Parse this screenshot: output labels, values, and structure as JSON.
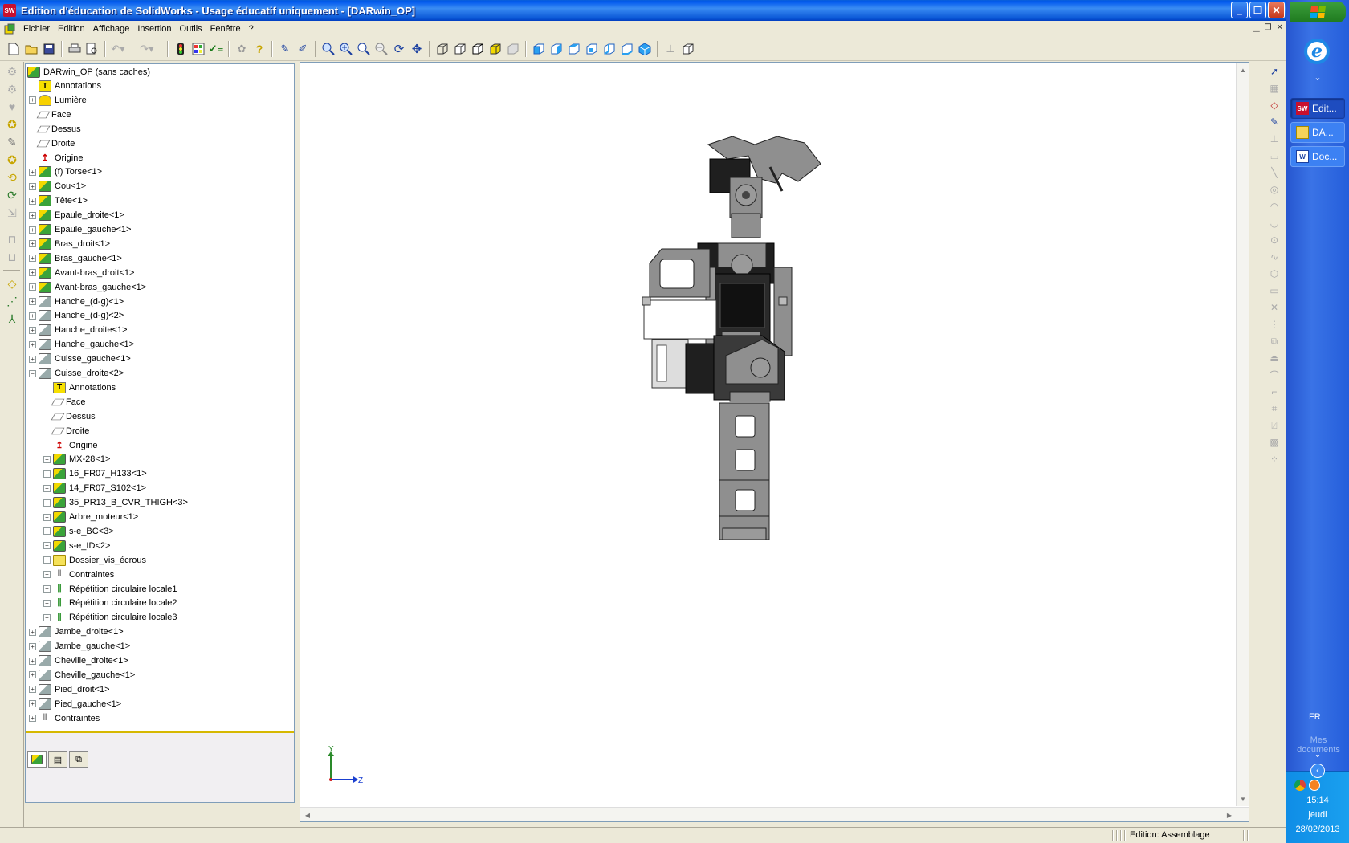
{
  "window": {
    "title": "Edition d'éducation de SolidWorks - Usage éducatif uniquement - [DARwin_OP]",
    "app_logo_text": "SW"
  },
  "menu": [
    "Fichier",
    "Edition",
    "Affichage",
    "Insertion",
    "Outils",
    "Fenêtre",
    "?"
  ],
  "tree": {
    "root": "DARwin_OP  (sans caches)",
    "items": [
      {
        "label": "Annotations",
        "icon": "annot",
        "level": 1,
        "expander": "none"
      },
      {
        "label": "Lumière",
        "icon": "light",
        "level": 1,
        "expander": "plus"
      },
      {
        "label": "Face",
        "icon": "plane",
        "level": 1,
        "expander": "none"
      },
      {
        "label": "Dessus",
        "icon": "plane",
        "level": 1,
        "expander": "none"
      },
      {
        "label": "Droite",
        "icon": "plane",
        "level": 1,
        "expander": "none"
      },
      {
        "label": "Origine",
        "icon": "origin",
        "level": 1,
        "expander": "none"
      },
      {
        "label": "(f) Torse<1>",
        "icon": "part",
        "level": 1,
        "expander": "plus"
      },
      {
        "label": "Cou<1>",
        "icon": "part",
        "level": 1,
        "expander": "plus"
      },
      {
        "label": "Tête<1>",
        "icon": "part",
        "level": 1,
        "expander": "plus"
      },
      {
        "label": "Epaule_droite<1>",
        "icon": "part",
        "level": 1,
        "expander": "plus"
      },
      {
        "label": "Epaule_gauche<1>",
        "icon": "part",
        "level": 1,
        "expander": "plus"
      },
      {
        "label": "Bras_droit<1>",
        "icon": "part",
        "level": 1,
        "expander": "plus"
      },
      {
        "label": "Bras_gauche<1>",
        "icon": "part",
        "level": 1,
        "expander": "plus"
      },
      {
        "label": "Avant-bras_droit<1>",
        "icon": "part",
        "level": 1,
        "expander": "plus"
      },
      {
        "label": "Avant-bras_gauche<1>",
        "icon": "part",
        "level": 1,
        "expander": "plus"
      },
      {
        "label": "Hanche_(d-g)<1>",
        "icon": "part-gray",
        "level": 1,
        "expander": "plus"
      },
      {
        "label": "Hanche_(d-g)<2>",
        "icon": "part-gray",
        "level": 1,
        "expander": "plus"
      },
      {
        "label": "Hanche_droite<1>",
        "icon": "part-gray",
        "level": 1,
        "expander": "plus"
      },
      {
        "label": "Hanche_gauche<1>",
        "icon": "part-gray",
        "level": 1,
        "expander": "plus"
      },
      {
        "label": "Cuisse_gauche<1>",
        "icon": "part-gray",
        "level": 1,
        "expander": "plus"
      },
      {
        "label": "Cuisse_droite<2>",
        "icon": "part-gray",
        "level": 1,
        "expander": "minus"
      },
      {
        "label": "Annotations",
        "icon": "annot",
        "level": 2,
        "expander": "none"
      },
      {
        "label": "Face",
        "icon": "plane",
        "level": 2,
        "expander": "none"
      },
      {
        "label": "Dessus",
        "icon": "plane",
        "level": 2,
        "expander": "none"
      },
      {
        "label": "Droite",
        "icon": "plane",
        "level": 2,
        "expander": "none"
      },
      {
        "label": "Origine",
        "icon": "origin",
        "level": 2,
        "expander": "none"
      },
      {
        "label": "MX-28<1>",
        "icon": "part",
        "level": 2,
        "expander": "plus"
      },
      {
        "label": "16_FR07_H133<1>",
        "icon": "part",
        "level": 2,
        "expander": "plus"
      },
      {
        "label": "14_FR07_S102<1>",
        "icon": "part",
        "level": 2,
        "expander": "plus"
      },
      {
        "label": "35_PR13_B_CVR_THIGH<3>",
        "icon": "part",
        "level": 2,
        "expander": "plus"
      },
      {
        "label": "Arbre_moteur<1>",
        "icon": "part",
        "level": 2,
        "expander": "plus"
      },
      {
        "label": "s-e_BC<3>",
        "icon": "part",
        "level": 2,
        "expander": "plus"
      },
      {
        "label": "s-e_ID<2>",
        "icon": "part",
        "level": 2,
        "expander": "plus"
      },
      {
        "label": "Dossier_vis_écrous",
        "icon": "folder",
        "level": 2,
        "expander": "plus"
      },
      {
        "label": "Contraintes",
        "icon": "mates",
        "level": 2,
        "expander": "plus"
      },
      {
        "label": "Répétition circulaire locale1",
        "icon": "pattern",
        "level": 2,
        "expander": "plus"
      },
      {
        "label": "Répétition circulaire locale2",
        "icon": "pattern",
        "level": 2,
        "expander": "plus"
      },
      {
        "label": "Répétition circulaire locale3",
        "icon": "pattern",
        "level": 2,
        "expander": "plus"
      },
      {
        "label": "Jambe_droite<1>",
        "icon": "part-gray",
        "level": 1,
        "expander": "plus"
      },
      {
        "label": "Jambe_gauche<1>",
        "icon": "part-gray",
        "level": 1,
        "expander": "plus"
      },
      {
        "label": "Cheville_droite<1>",
        "icon": "part-gray",
        "level": 1,
        "expander": "plus"
      },
      {
        "label": "Cheville_gauche<1>",
        "icon": "part-gray",
        "level": 1,
        "expander": "plus"
      },
      {
        "label": "Pied_droit<1>",
        "icon": "part-gray",
        "level": 1,
        "expander": "plus"
      },
      {
        "label": "Pied_gauche<1>",
        "icon": "part-gray",
        "level": 1,
        "expander": "plus"
      },
      {
        "label": "Contraintes",
        "icon": "mates",
        "level": 1,
        "expander": "plus"
      }
    ]
  },
  "triad": {
    "y_label": "Y",
    "z_label": "Z"
  },
  "status": {
    "text": "Edition: Assemblage"
  },
  "taskbar": {
    "buttons": [
      {
        "label": "Edit...",
        "icon": "solidworks-icon",
        "active": true
      },
      {
        "label": "DA...",
        "icon": "folder-icon",
        "active": false
      },
      {
        "label": "Doc...",
        "icon": "word-icon",
        "active": false
      }
    ],
    "language": "FR",
    "mes_documents": "Mes documents",
    "clock_time": "15:14",
    "clock_day": "jeudi",
    "clock_date": "28/02/2013"
  },
  "colors": {
    "titlebar": "#0058ee",
    "taskbar": "#245edb",
    "tray": "#0f8de6",
    "tree_underline": "#d6b800",
    "model_gray": "#8f8f8f",
    "model_dark": "#1f1f1f"
  }
}
